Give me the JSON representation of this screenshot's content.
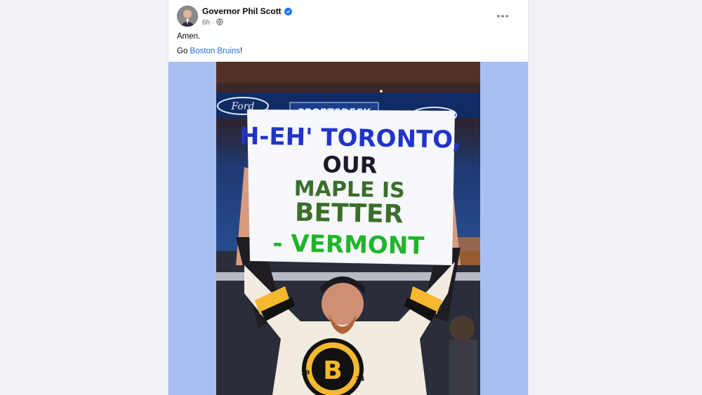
{
  "post": {
    "author": "Governor Phil Scott",
    "time": "6h",
    "text_line1": "Amen.",
    "text_line2_prefix": "Go ",
    "text_line2_link": "Boston Bruins",
    "text_line2_suffix": "!"
  },
  "image": {
    "banner_brand": "SPORTSDECK",
    "sign_line1": "H-EH' TORONTO,",
    "sign_line2": "OUR",
    "sign_line3": "MAPLE IS",
    "sign_line4": "BETTER",
    "sign_line5": "- VERMONT",
    "logo_letter": "B",
    "logo_num_left": "19",
    "logo_num_right": "24"
  },
  "colors": {
    "link": "#216fdb",
    "verified": "#1877f2",
    "media_bg": "#a9bff3"
  },
  "icons": [
    "verified-icon",
    "globe-icon",
    "more-options-icon"
  ]
}
